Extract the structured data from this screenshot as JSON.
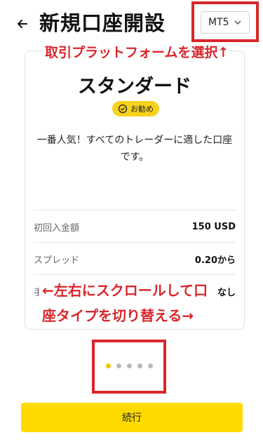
{
  "header": {
    "title": "新規口座開設",
    "back_icon": "arrow-left-icon",
    "platform_select": {
      "value": "MT5",
      "icon": "chevron-down-icon"
    }
  },
  "annotations": {
    "platform_hint": "取引プラットフォームを選択↑",
    "scroll_hint_line1": "←左右にスクロールして口",
    "scroll_hint_line2": "座タイプを切り替える→",
    "highlight_color": "#d9262b"
  },
  "account_card": {
    "title": "スタンダード",
    "badge": {
      "icon": "check-circle-icon",
      "label": "お勧め"
    },
    "description_line1": "一番人気！すべてのトレーダーに適した口座",
    "description_line2": "です。",
    "rows": [
      {
        "label": "初回入金額",
        "value": "150 USD"
      },
      {
        "label": "スプレッド",
        "value": "0.20から"
      },
      {
        "label": "手",
        "value": "なし"
      }
    ]
  },
  "carousel": {
    "total": 5,
    "active_index": 0,
    "active_color": "#f2c300",
    "inactive_color": "#b9b9b9"
  },
  "footer": {
    "continue_label": "続行",
    "button_color": "#ffda00"
  }
}
